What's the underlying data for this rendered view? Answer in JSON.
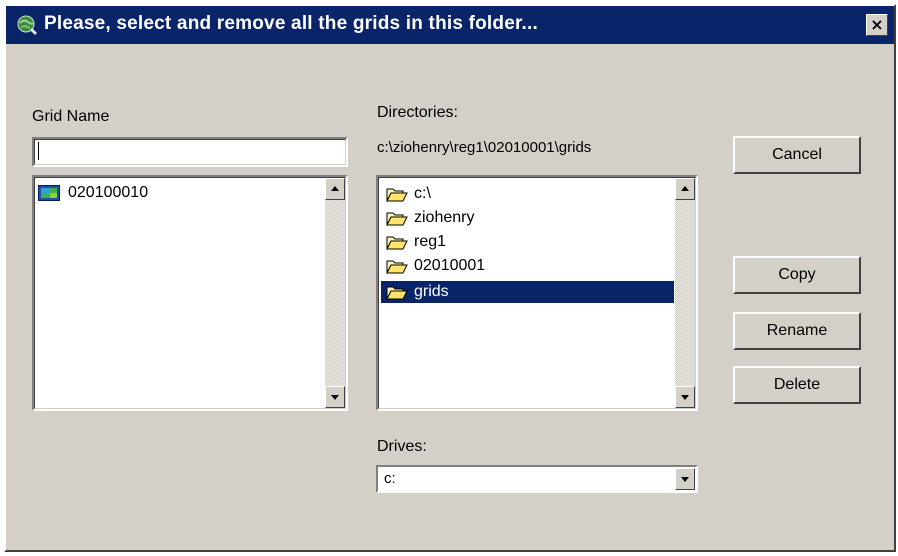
{
  "dialog": {
    "title": "Please, select and remove all the grids in this folder...",
    "close_glyph": "×"
  },
  "grid_name": {
    "label": "Grid Name",
    "value": ""
  },
  "grid_list": {
    "items": [
      {
        "label": "020100010",
        "icon": "grid-raster-icon"
      }
    ]
  },
  "directories": {
    "label": "Directories:",
    "current_path": "c:\\ziohenry\\reg1\\02010001\\grids",
    "items": [
      {
        "label": "c:\\",
        "icon": "folder-open-icon",
        "selected": false
      },
      {
        "label": "ziohenry",
        "icon": "folder-open-icon",
        "selected": false
      },
      {
        "label": "reg1",
        "icon": "folder-open-icon",
        "selected": false
      },
      {
        "label": "02010001",
        "icon": "folder-open-icon",
        "selected": false
      },
      {
        "label": "grids",
        "icon": "folder-open-icon",
        "selected": true
      }
    ]
  },
  "drives": {
    "label": "Drives:",
    "value": "c:"
  },
  "buttons": {
    "cancel": "Cancel",
    "copy": "Copy",
    "rename": "Rename",
    "delete": "Delete"
  },
  "colors": {
    "titlebar": "#0a246a",
    "face": "#d4d0c8",
    "selection": "#0a246a"
  }
}
